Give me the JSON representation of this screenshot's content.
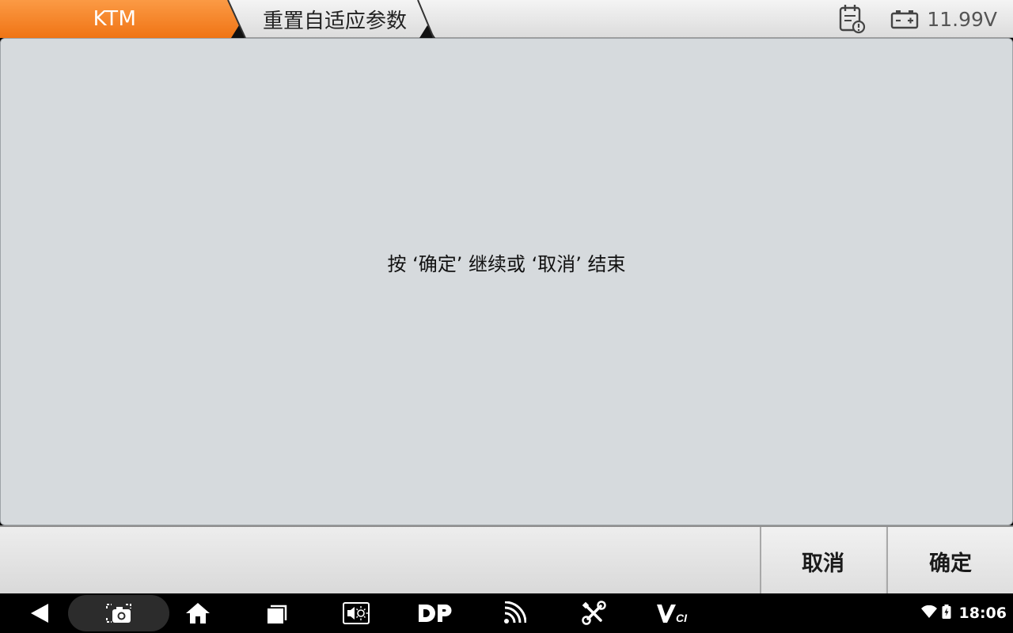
{
  "header": {
    "brand": "KTM",
    "page_title": "重置自适应参数",
    "voltage": "11.99V",
    "brand_color": "#f58220"
  },
  "main": {
    "message": "按 ‘确定’ 继续或 ‘取消’ 结束"
  },
  "actions": {
    "cancel_label": "取消",
    "ok_label": "确定"
  },
  "nav": {
    "icons": [
      "back-icon",
      "screenshot-icon",
      "home-icon",
      "recents-icon",
      "brightness-icon",
      "dp-icon",
      "cast-icon",
      "tools-icon",
      "vci-icon"
    ]
  },
  "status_bar": {
    "time": "18:06",
    "icons": [
      "wifi-icon",
      "battery-icon"
    ]
  }
}
